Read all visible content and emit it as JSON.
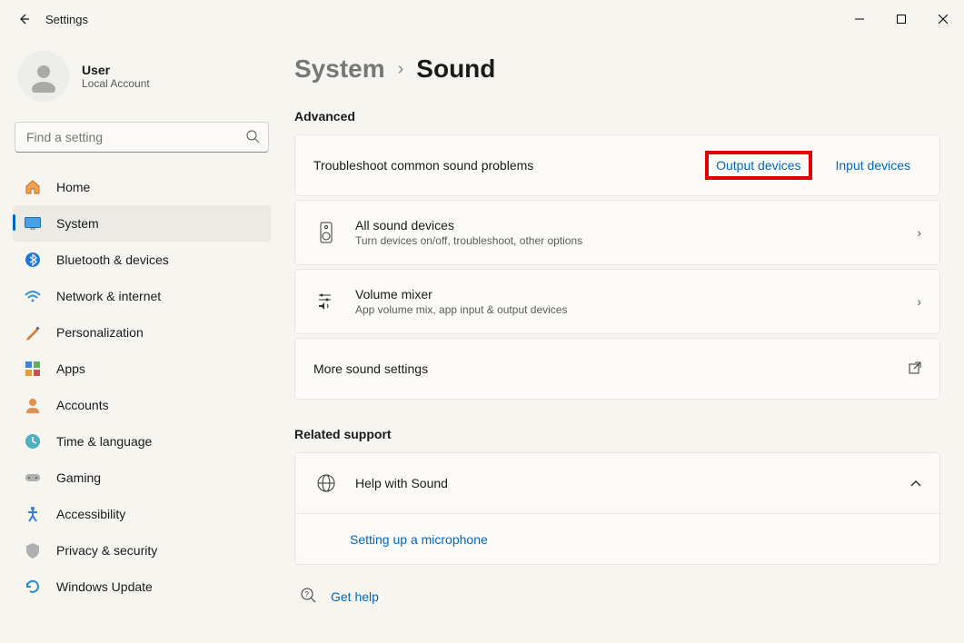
{
  "window": {
    "title": "Settings"
  },
  "user": {
    "name": "User",
    "type": "Local Account"
  },
  "search": {
    "placeholder": "Find a setting"
  },
  "nav": {
    "home": "Home",
    "system": "System",
    "bluetooth": "Bluetooth & devices",
    "network": "Network & internet",
    "personalization": "Personalization",
    "apps": "Apps",
    "accounts": "Accounts",
    "time": "Time & language",
    "gaming": "Gaming",
    "accessibility": "Accessibility",
    "privacy": "Privacy & security",
    "update": "Windows Update"
  },
  "breadcrumb": {
    "parent": "System",
    "current": "Sound"
  },
  "sections": {
    "advanced": "Advanced",
    "related": "Related support"
  },
  "rows": {
    "troubleshoot": {
      "title": "Troubleshoot common sound problems",
      "output": "Output devices",
      "input": "Input devices"
    },
    "allDevices": {
      "title": "All sound devices",
      "sub": "Turn devices on/off, troubleshoot, other options"
    },
    "mixer": {
      "title": "Volume mixer",
      "sub": "App volume mix, app input & output devices"
    },
    "more": {
      "title": "More sound settings"
    },
    "help": {
      "title": "Help with Sound",
      "sub": "Setting up a microphone"
    }
  },
  "getHelp": "Get help"
}
